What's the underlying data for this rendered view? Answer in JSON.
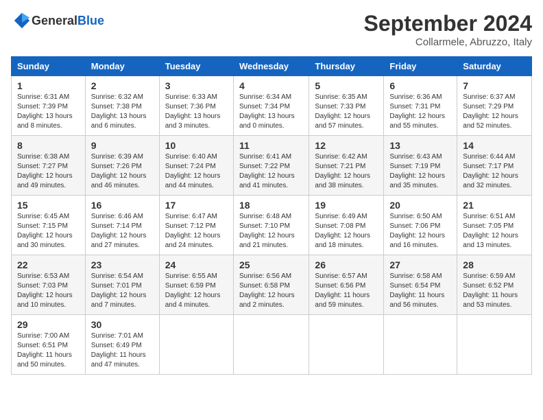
{
  "logo": {
    "text_general": "General",
    "text_blue": "Blue"
  },
  "header": {
    "month_year": "September 2024",
    "location": "Collarmele, Abruzzo, Italy"
  },
  "days_of_week": [
    "Sunday",
    "Monday",
    "Tuesday",
    "Wednesday",
    "Thursday",
    "Friday",
    "Saturday"
  ],
  "weeks": [
    [
      {
        "day": "1",
        "info": "Sunrise: 6:31 AM\nSunset: 7:39 PM\nDaylight: 13 hours\nand 8 minutes."
      },
      {
        "day": "2",
        "info": "Sunrise: 6:32 AM\nSunset: 7:38 PM\nDaylight: 13 hours\nand 6 minutes."
      },
      {
        "day": "3",
        "info": "Sunrise: 6:33 AM\nSunset: 7:36 PM\nDaylight: 13 hours\nand 3 minutes."
      },
      {
        "day": "4",
        "info": "Sunrise: 6:34 AM\nSunset: 7:34 PM\nDaylight: 13 hours\nand 0 minutes."
      },
      {
        "day": "5",
        "info": "Sunrise: 6:35 AM\nSunset: 7:33 PM\nDaylight: 12 hours\nand 57 minutes."
      },
      {
        "day": "6",
        "info": "Sunrise: 6:36 AM\nSunset: 7:31 PM\nDaylight: 12 hours\nand 55 minutes."
      },
      {
        "day": "7",
        "info": "Sunrise: 6:37 AM\nSunset: 7:29 PM\nDaylight: 12 hours\nand 52 minutes."
      }
    ],
    [
      {
        "day": "8",
        "info": "Sunrise: 6:38 AM\nSunset: 7:27 PM\nDaylight: 12 hours\nand 49 minutes."
      },
      {
        "day": "9",
        "info": "Sunrise: 6:39 AM\nSunset: 7:26 PM\nDaylight: 12 hours\nand 46 minutes."
      },
      {
        "day": "10",
        "info": "Sunrise: 6:40 AM\nSunset: 7:24 PM\nDaylight: 12 hours\nand 44 minutes."
      },
      {
        "day": "11",
        "info": "Sunrise: 6:41 AM\nSunset: 7:22 PM\nDaylight: 12 hours\nand 41 minutes."
      },
      {
        "day": "12",
        "info": "Sunrise: 6:42 AM\nSunset: 7:21 PM\nDaylight: 12 hours\nand 38 minutes."
      },
      {
        "day": "13",
        "info": "Sunrise: 6:43 AM\nSunset: 7:19 PM\nDaylight: 12 hours\nand 35 minutes."
      },
      {
        "day": "14",
        "info": "Sunrise: 6:44 AM\nSunset: 7:17 PM\nDaylight: 12 hours\nand 32 minutes."
      }
    ],
    [
      {
        "day": "15",
        "info": "Sunrise: 6:45 AM\nSunset: 7:15 PM\nDaylight: 12 hours\nand 30 minutes."
      },
      {
        "day": "16",
        "info": "Sunrise: 6:46 AM\nSunset: 7:14 PM\nDaylight: 12 hours\nand 27 minutes."
      },
      {
        "day": "17",
        "info": "Sunrise: 6:47 AM\nSunset: 7:12 PM\nDaylight: 12 hours\nand 24 minutes."
      },
      {
        "day": "18",
        "info": "Sunrise: 6:48 AM\nSunset: 7:10 PM\nDaylight: 12 hours\nand 21 minutes."
      },
      {
        "day": "19",
        "info": "Sunrise: 6:49 AM\nSunset: 7:08 PM\nDaylight: 12 hours\nand 18 minutes."
      },
      {
        "day": "20",
        "info": "Sunrise: 6:50 AM\nSunset: 7:06 PM\nDaylight: 12 hours\nand 16 minutes."
      },
      {
        "day": "21",
        "info": "Sunrise: 6:51 AM\nSunset: 7:05 PM\nDaylight: 12 hours\nand 13 minutes."
      }
    ],
    [
      {
        "day": "22",
        "info": "Sunrise: 6:53 AM\nSunset: 7:03 PM\nDaylight: 12 hours\nand 10 minutes."
      },
      {
        "day": "23",
        "info": "Sunrise: 6:54 AM\nSunset: 7:01 PM\nDaylight: 12 hours\nand 7 minutes."
      },
      {
        "day": "24",
        "info": "Sunrise: 6:55 AM\nSunset: 6:59 PM\nDaylight: 12 hours\nand 4 minutes."
      },
      {
        "day": "25",
        "info": "Sunrise: 6:56 AM\nSunset: 6:58 PM\nDaylight: 12 hours\nand 2 minutes."
      },
      {
        "day": "26",
        "info": "Sunrise: 6:57 AM\nSunset: 6:56 PM\nDaylight: 11 hours\nand 59 minutes."
      },
      {
        "day": "27",
        "info": "Sunrise: 6:58 AM\nSunset: 6:54 PM\nDaylight: 11 hours\nand 56 minutes."
      },
      {
        "day": "28",
        "info": "Sunrise: 6:59 AM\nSunset: 6:52 PM\nDaylight: 11 hours\nand 53 minutes."
      }
    ],
    [
      {
        "day": "29",
        "info": "Sunrise: 7:00 AM\nSunset: 6:51 PM\nDaylight: 11 hours\nand 50 minutes."
      },
      {
        "day": "30",
        "info": "Sunrise: 7:01 AM\nSunset: 6:49 PM\nDaylight: 11 hours\nand 47 minutes."
      },
      {
        "day": "",
        "info": ""
      },
      {
        "day": "",
        "info": ""
      },
      {
        "day": "",
        "info": ""
      },
      {
        "day": "",
        "info": ""
      },
      {
        "day": "",
        "info": ""
      }
    ]
  ]
}
